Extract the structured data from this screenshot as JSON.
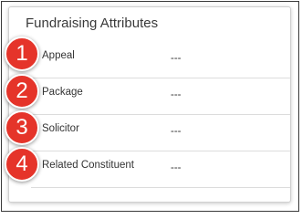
{
  "card": {
    "title": "Fundraising Attributes",
    "fields": [
      {
        "label": "Appeal",
        "value": "---"
      },
      {
        "label": "Package",
        "value": "---"
      },
      {
        "label": "Solicitor",
        "value": "---"
      },
      {
        "label": "Related Constituent",
        "value": "---"
      }
    ]
  },
  "badges": [
    "1",
    "2",
    "3",
    "4"
  ],
  "colors": {
    "badge": "#e5342a",
    "divider": "#dcdcdc",
    "text": "#333333"
  }
}
